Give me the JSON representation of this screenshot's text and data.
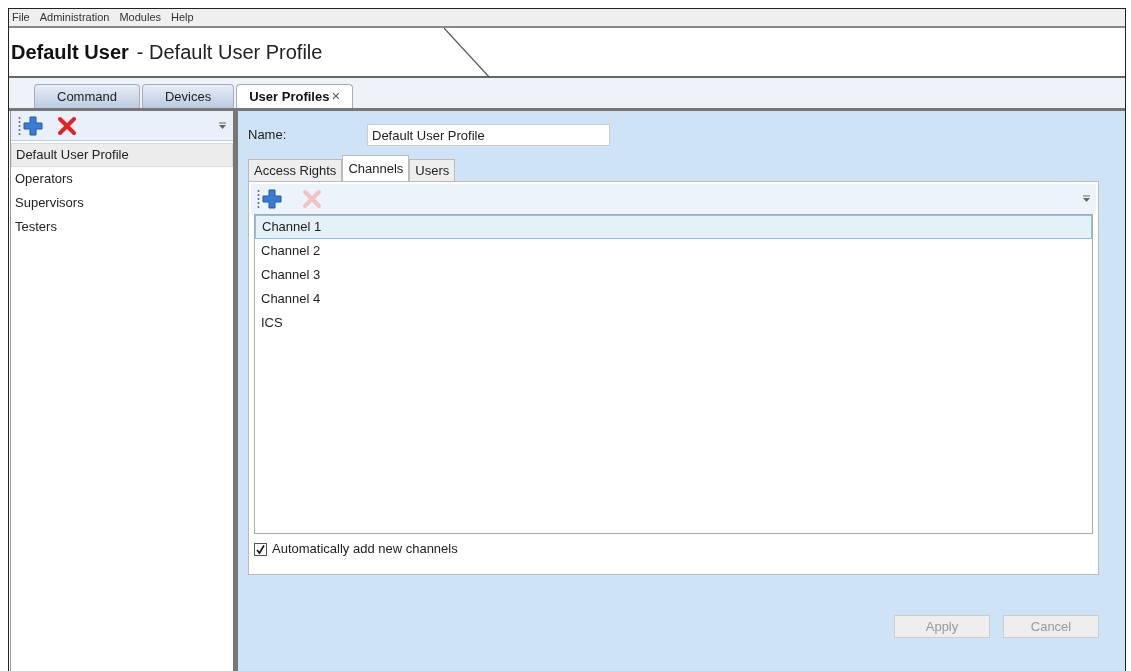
{
  "menu": [
    "File",
    "Administration",
    "Modules",
    "Help"
  ],
  "title": {
    "bold": "Default User",
    "rest": "- Default User Profile"
  },
  "tabs": [
    {
      "label": "Command",
      "selected": false
    },
    {
      "label": "Devices",
      "selected": false
    },
    {
      "label": "User Profiles",
      "selected": true,
      "close": "×"
    }
  ],
  "profiles_toolbar": {
    "delete_disabled": false
  },
  "profiles": [
    {
      "label": "Default User Profile",
      "selected": true
    },
    {
      "label": "Operators",
      "selected": false
    },
    {
      "label": "Supervisors",
      "selected": false
    },
    {
      "label": "Testers",
      "selected": false
    }
  ],
  "name_field": {
    "label": "Name:",
    "value": "Default User Profile"
  },
  "inner_tabs": [
    {
      "label": "Access Rights",
      "selected": false
    },
    {
      "label": "Channels",
      "selected": true
    },
    {
      "label": "Users",
      "selected": false
    }
  ],
  "channels_toolbar": {
    "delete_disabled": true
  },
  "channels": [
    {
      "label": "Channel 1",
      "selected": true
    },
    {
      "label": "Channel 2",
      "selected": false
    },
    {
      "label": "Channel 3",
      "selected": false
    },
    {
      "label": "Channel 4",
      "selected": false
    },
    {
      "label": "ICS",
      "selected": false
    }
  ],
  "auto_add": {
    "label": "Automatically add new channels",
    "checked": true
  },
  "buttons": [
    {
      "label": "Apply",
      "disabled": true
    },
    {
      "label": "Cancel",
      "disabled": true
    }
  ]
}
